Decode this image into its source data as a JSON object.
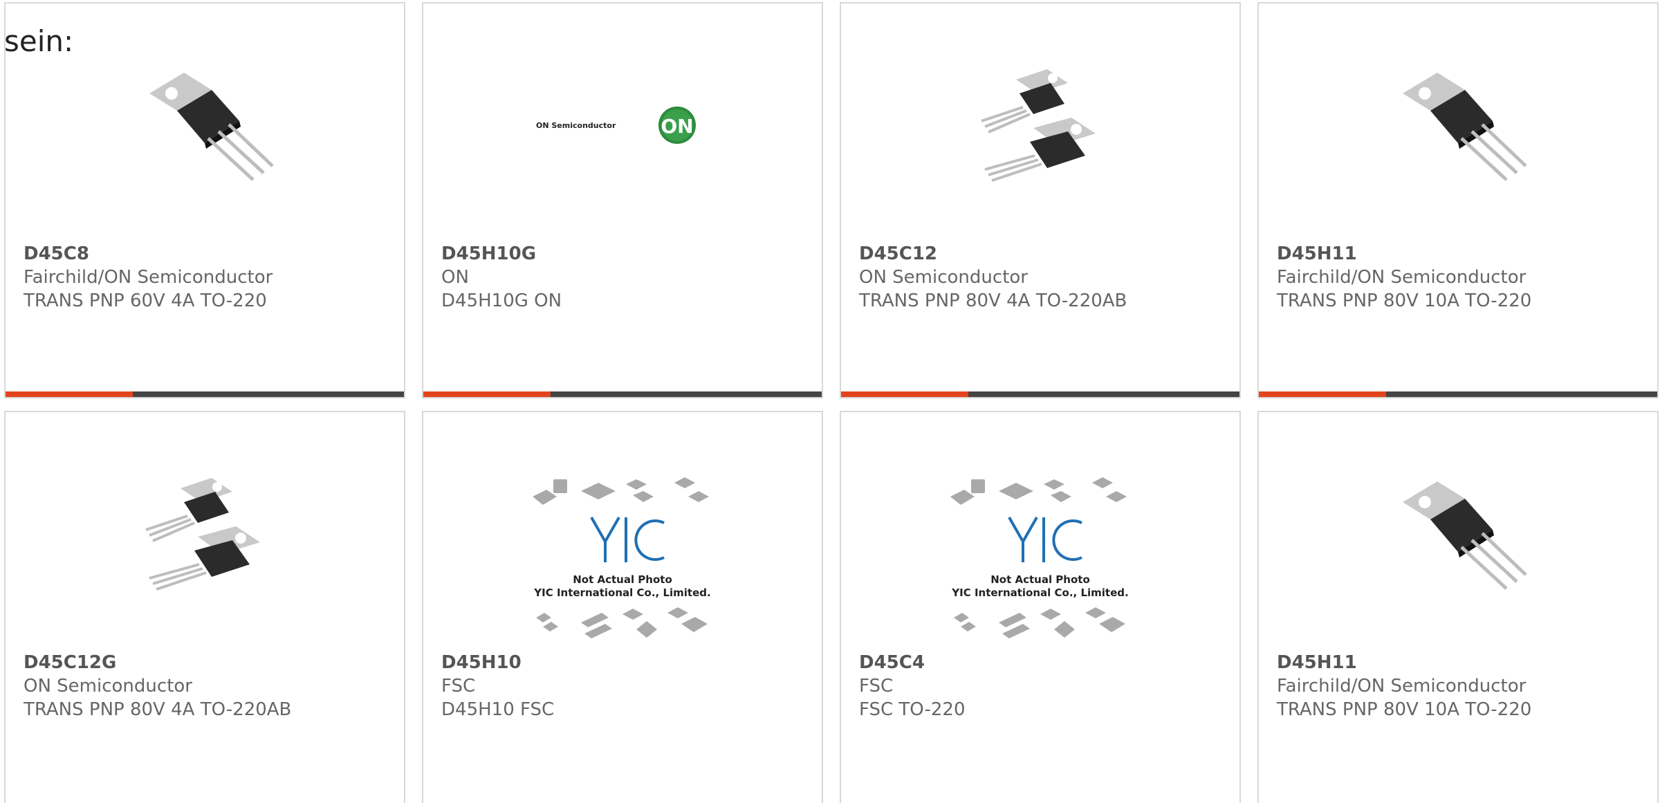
{
  "intro_text": "sein:",
  "colors": {
    "accent": "#e4441c",
    "bar": "#444444",
    "border": "#d8d8d8",
    "text": "#666666",
    "on_logo": "#2e8b3e"
  },
  "products": [
    {
      "part_number": "D45C8",
      "manufacturer": "Fairchild/ON Semiconductor",
      "description": "TRANS PNP 60V 4A TO-220",
      "image": "to220-single-transistor-photo"
    },
    {
      "part_number": "D45H10G",
      "manufacturer": "ON",
      "description": "D45H10G ON",
      "image": "on-semiconductor-logo",
      "logo_text": "ON Semiconductor",
      "logo_badge": "ON"
    },
    {
      "part_number": "D45C12",
      "manufacturer": "ON Semiconductor",
      "description": "TRANS PNP 80V 4A TO-220AB",
      "image": "to220-pair-transistor-photo"
    },
    {
      "part_number": "D45H11",
      "manufacturer": "Fairchild/ON Semiconductor",
      "description": "TRANS PNP 80V 10A TO-220",
      "image": "to220-single-transistor-photo"
    },
    {
      "part_number": "D45C12G",
      "manufacturer": "ON Semiconductor",
      "description": "TRANS PNP 80V 4A TO-220AB",
      "image": "to220-pair-transistor-photo"
    },
    {
      "part_number": "D45H10",
      "manufacturer": "FSC",
      "description": "D45H10 FSC",
      "image": "yic-placeholder-photo",
      "placeholder_line1": "Not Actual Photo",
      "placeholder_line2": "YIC International Co., Limited."
    },
    {
      "part_number": "D45C4",
      "manufacturer": "FSC",
      "description": "FSC TO-220",
      "image": "yic-placeholder-photo",
      "placeholder_line1": "Not Actual Photo",
      "placeholder_line2": "YIC International Co., Limited."
    },
    {
      "part_number": "D45H11",
      "manufacturer": "Fairchild/ON Semiconductor",
      "description": "TRANS PNP 80V 10A TO-220",
      "image": "to220-single-transistor-photo"
    }
  ]
}
